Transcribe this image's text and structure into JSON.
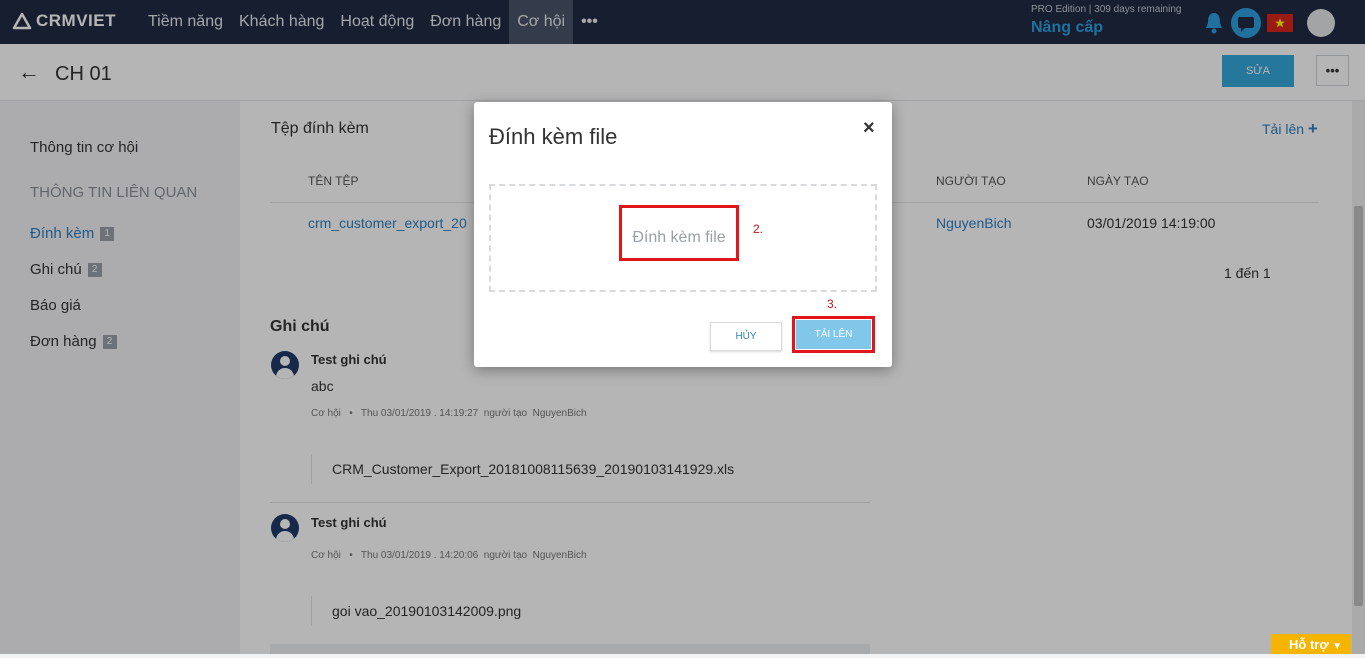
{
  "nav": {
    "brand": "CRMVIET",
    "menu": [
      "Tiềm năng",
      "Khách hàng",
      "Hoạt động",
      "Đơn hàng",
      "Cơ hội"
    ],
    "active_index": 4,
    "more": "•••",
    "edition": "PRO Edition | 309 days remaining",
    "upgrade": "Nâng cấp"
  },
  "header": {
    "title": "CH 01",
    "edit_label": "SỬA",
    "more_label": "•••"
  },
  "sidebar": {
    "info": "Thông tin cơ hội",
    "section": "THÔNG TIN LIÊN QUAN",
    "items": [
      {
        "label": "Đính kèm",
        "count": "1"
      },
      {
        "label": "Ghi chú",
        "count": "2"
      },
      {
        "label": "Báo giá",
        "count": ""
      },
      {
        "label": "Đơn hàng",
        "count": "2"
      }
    ]
  },
  "attachments": {
    "title": "Tệp đính kèm",
    "upload_link": "Tải lên",
    "columns": [
      "TÊN TỆP",
      "NGƯỜI TẠO",
      "NGÀY TẠO"
    ],
    "rows": [
      {
        "name": "crm_customer_export_20",
        "creator": "NguyenBich",
        "date": "03/01/2019 14:19:00"
      }
    ],
    "pagination": "1 đến 1"
  },
  "notes": {
    "title": "Ghi chú",
    "items": [
      {
        "title": "Test ghi chú",
        "body": "abc",
        "category": "Cơ hội",
        "time": "Thu 03/01/2019 . 14:19:27",
        "by_label": "người tạo",
        "author": "NguyenBich",
        "file": "CRM_Customer_Export_20181008115639_20190103141929.xls"
      },
      {
        "title": "Test ghi chú",
        "body": "",
        "category": "Cơ hội",
        "time": "Thu 03/01/2019 . 14:20:06",
        "by_label": "người tạo",
        "author": "NguyenBich",
        "file": "goi vao_20190103142009.png"
      }
    ]
  },
  "modal": {
    "title": "Đính kèm file",
    "close": "×",
    "dropzone": "Đính kèm file",
    "step2": "2.",
    "step3": "3.",
    "cancel": "HỦY",
    "upload": "TẢI LÊN"
  },
  "help": "Hỗ trợ",
  "colors": {
    "nav": "#1f2b44",
    "accent": "#35a8dc",
    "link": "#2f7fc0",
    "highlight": "#e0161b",
    "help": "#f5b400"
  }
}
